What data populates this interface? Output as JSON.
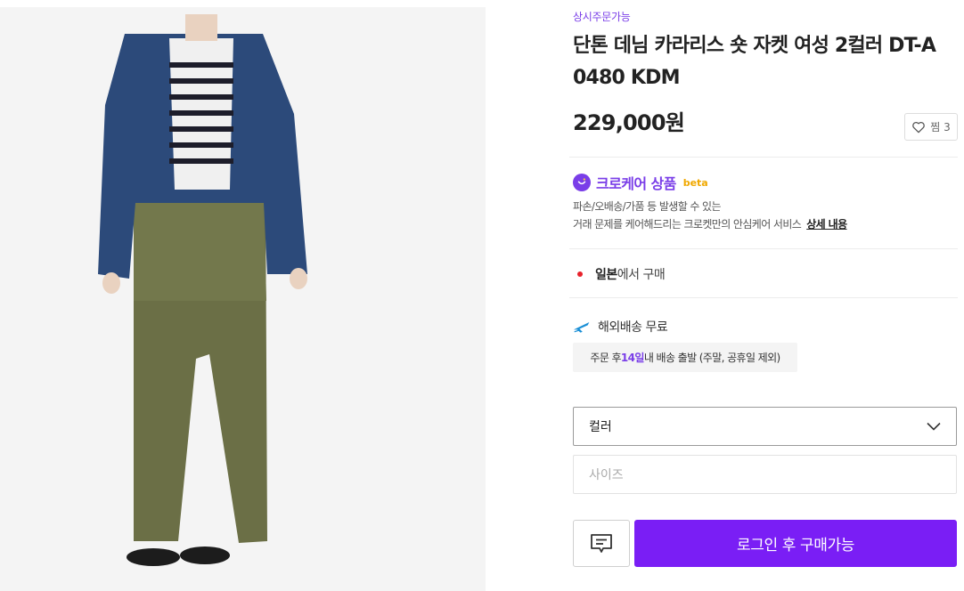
{
  "product": {
    "badge": "상시주문가능",
    "title": "단톤 데님 카라리스 숏 자켓 여성 2컬러 DT-A 0480 KDM",
    "price": "229,000원",
    "like_label": "찜 3"
  },
  "care": {
    "title": "크로케어 상품",
    "beta": "beta",
    "desc_line1": "파손/오배송/가품 등 발생할 수 있는",
    "desc_line2": "거래 문제를 케어해드리는 크로켓만의 안심케어 서비스",
    "link": "상세 내용"
  },
  "origin": {
    "country": "일본",
    "suffix": "에서 구매"
  },
  "shipping": {
    "label": "해외배송 무료",
    "note_prefix": "주문 후 ",
    "note_days": "14일",
    "note_suffix": " 내 배송 출발 (주말, 공휴일 제외)"
  },
  "options": {
    "color_label": "컬러",
    "size_label": "사이즈"
  },
  "actions": {
    "buy_label": "로그인 후 구매가능"
  },
  "colors": {
    "accent": "#7a3ee8",
    "buy_button": "#7a1ef5",
    "origin_dot": "#e8222b",
    "beta": "#f0a800"
  },
  "icons": {
    "like": "heart-icon",
    "care": "crocare-icon",
    "shipping": "airplane-icon",
    "dropdown": "chevron-down-icon",
    "chat": "chat-icon"
  }
}
